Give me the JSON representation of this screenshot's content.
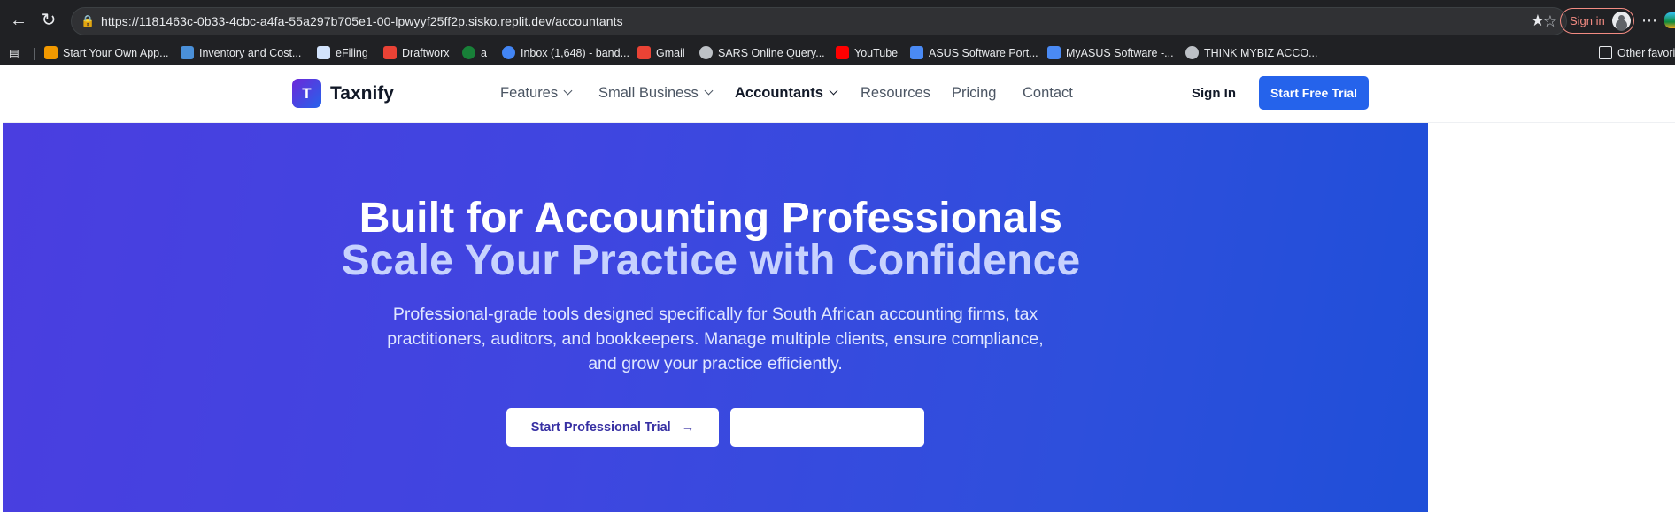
{
  "browser": {
    "url_base": "https://1181463c-0b33-4cbc-a4fa-55a297b705e1-00-lpwyyf25ff2p.sisko.replit.dev",
    "url_path": "/accountants",
    "signin_label": "Sign in",
    "bookmarks": [
      {
        "label": "Start Your Own App...",
        "icon": "app-icon",
        "color": "#f29900"
      },
      {
        "label": "Inventory and Cost...",
        "icon": "ac-icon",
        "color": "#4a90d9"
      },
      {
        "label": "eFiling",
        "icon": "efiling-icon",
        "color": "#d2e3fc"
      },
      {
        "label": "Draftworx",
        "icon": "draftworx-icon",
        "color": "#e94235"
      },
      {
        "label": "a",
        "icon": "green-circle-icon",
        "color": "#188038"
      },
      {
        "label": "Inbox (1,648) - band...",
        "icon": "google-icon",
        "color": "#4285f4"
      },
      {
        "label": "Gmail",
        "icon": "gmail-icon",
        "color": "#ea4335"
      },
      {
        "label": "SARS Online Query...",
        "icon": "globe-icon",
        "color": "#bdc1c6"
      },
      {
        "label": "YouTube",
        "icon": "youtube-icon",
        "color": "#ff0000"
      },
      {
        "label": "ASUS Software Port...",
        "icon": "asus-icon",
        "color": "#4a8af4"
      },
      {
        "label": "MyASUS Software -...",
        "icon": "asus-icon",
        "color": "#4a8af4"
      },
      {
        "label": "THINK MYBIZ ACCO...",
        "icon": "gear-globe-icon",
        "color": "#bdc1c6"
      },
      {
        "label": "Other favorites",
        "icon": "folder-icon",
        "color": "#e8eaed"
      }
    ]
  },
  "site": {
    "logo_letter": "T",
    "brand": "Taxnify",
    "menu": [
      "Features",
      "Small Business",
      "Accountants",
      "Resources",
      "Pricing",
      "Contact"
    ],
    "active_menu": "Accountants",
    "signin": "Sign In",
    "trial": "Start Free Trial"
  },
  "hero": {
    "title": "Built for Accounting Professionals",
    "subtitle": "Scale Your Practice with Confidence",
    "description": "Professional-grade tools designed specifically for South African accounting firms, tax practitioners, auditors, and bookkeepers. Manage multiple clients, ensure compliance, and grow your practice efficiently.",
    "primary_cta": "Start Professional Trial",
    "secondary_cta": ""
  }
}
